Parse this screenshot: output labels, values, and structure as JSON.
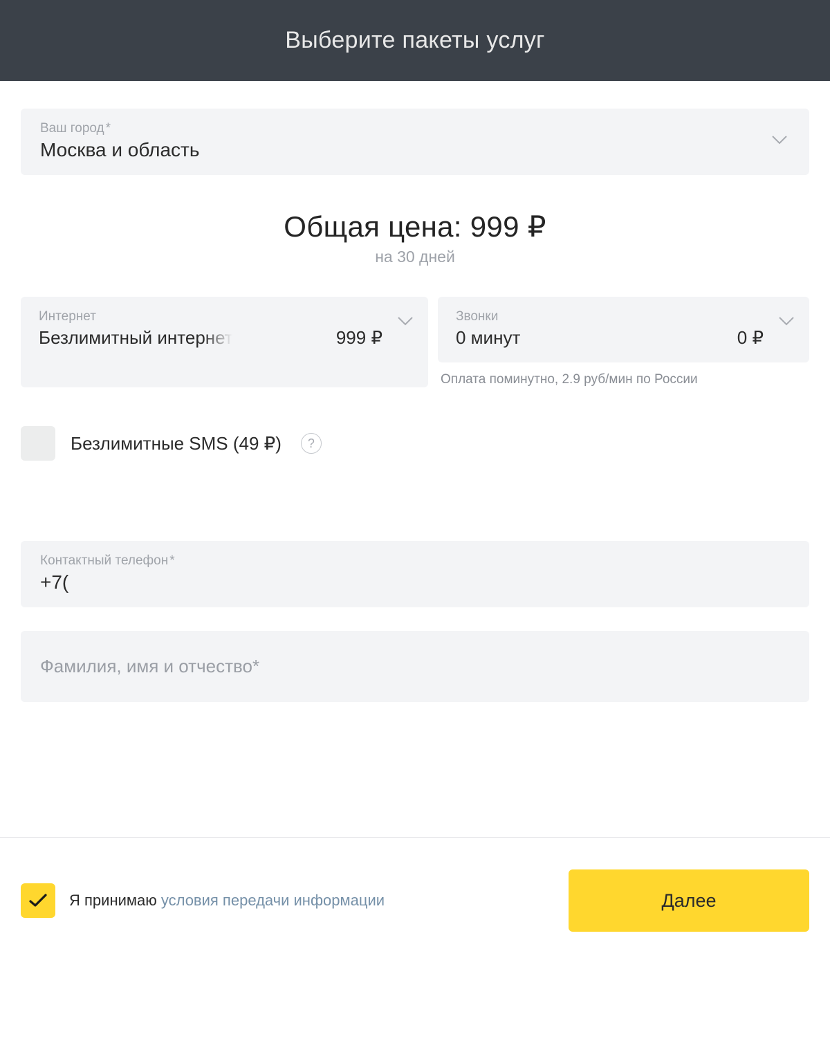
{
  "header": {
    "title": "Выберите пакеты услуг"
  },
  "city": {
    "label": "Ваш город",
    "value": "Москва и область"
  },
  "price": {
    "main": "Общая цена: 999 ₽",
    "sub": "на 30 дней"
  },
  "internet": {
    "label": "Интернет",
    "value": "Безлимитный интернет",
    "price": "999 ₽"
  },
  "calls": {
    "label": "Звонки",
    "value": "0 минут",
    "price": "0 ₽",
    "hint": "Оплата поминутно, 2.9 руб/мин по России"
  },
  "sms": {
    "label": "Безлимитные SMS (49 ₽)"
  },
  "phone": {
    "label": "Контактный телефон",
    "value": "+7("
  },
  "name": {
    "placeholder": "Фамилия, имя и отчество*"
  },
  "consent": {
    "text": "Я принимаю ",
    "link": "условия передачи информации"
  },
  "next": {
    "label": "Далее"
  }
}
